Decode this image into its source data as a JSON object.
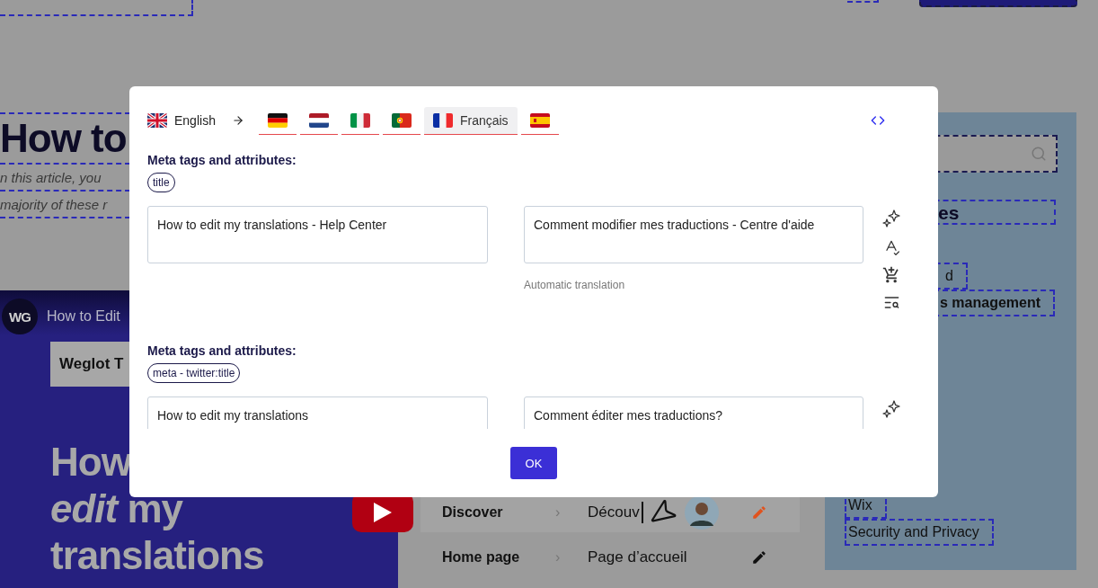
{
  "background_page": {
    "article": {
      "heading": "How to",
      "intro_lines": [
        "n this article, you",
        "majority of these r"
      ]
    },
    "video": {
      "channel_logo": "WG",
      "title": "How to Edit",
      "banner": "Weglot T",
      "headline": [
        "How",
        "*edit* my",
        "translations"
      ]
    },
    "table_rows": [
      {
        "original": "Discover",
        "separator": "›",
        "translation": "Découv",
        "highlighted": true
      },
      {
        "original": "Home page",
        "separator": "›",
        "translation": "Page d’accueil",
        "highlighted": false
      }
    ],
    "sidebar": {
      "heading": "es",
      "upper_links": [
        {
          "label": "d",
          "kind": "link"
        },
        {
          "label": "s management",
          "kind": "category"
        }
      ],
      "lower_links": [
        {
          "label": "Wix"
        },
        {
          "label": "Security and Privacy"
        }
      ]
    }
  },
  "dialog": {
    "source_language": {
      "kind": "uk",
      "label": "English"
    },
    "target_languages": [
      {
        "kind": "de",
        "selected": false
      },
      {
        "kind": "nl",
        "selected": false
      },
      {
        "kind": "it",
        "selected": false
      },
      {
        "kind": "pt",
        "selected": false
      },
      {
        "kind": "fr",
        "label": "Français",
        "selected": true
      },
      {
        "kind": "es",
        "selected": false
      }
    ],
    "entries": [
      {
        "heading": "Meta tags and attributes:",
        "tag": "title",
        "source": "How to edit my translations - Help Center",
        "translation": "Comment modifier mes traductions - Centre d'aide",
        "note": "Automatic translation",
        "tools": [
          {
            "kind": "ai"
          },
          {
            "kind": "spellcheck"
          },
          {
            "kind": "cart"
          },
          {
            "kind": "search"
          }
        ]
      },
      {
        "heading": "Meta tags and attributes:",
        "tag": "meta - twitter:title",
        "source": "How to edit my translations",
        "translation": "Comment éditer mes traductions?",
        "tools": [
          {
            "kind": "ai"
          }
        ]
      }
    ],
    "ok_button": "OK"
  }
}
